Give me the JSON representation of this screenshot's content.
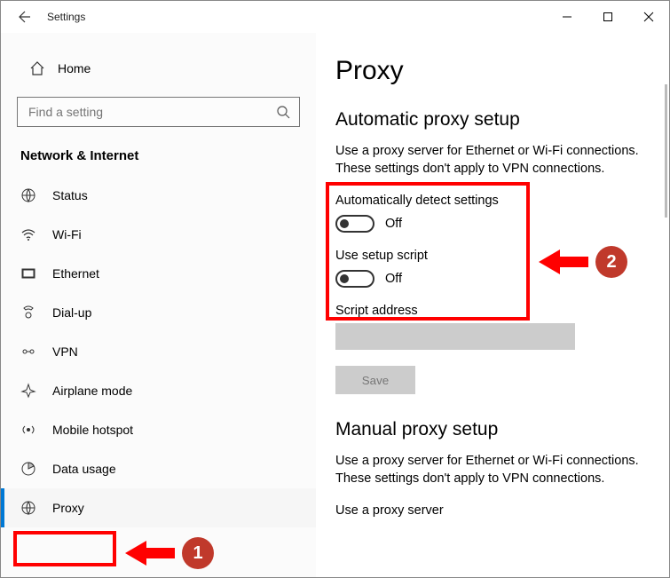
{
  "window": {
    "title": "Settings"
  },
  "sidebar": {
    "home": "Home",
    "search_placeholder": "Find a setting",
    "section": "Network & Internet",
    "items": [
      {
        "label": "Status"
      },
      {
        "label": "Wi-Fi"
      },
      {
        "label": "Ethernet"
      },
      {
        "label": "Dial-up"
      },
      {
        "label": "VPN"
      },
      {
        "label": "Airplane mode"
      },
      {
        "label": "Mobile hotspot"
      },
      {
        "label": "Data usage"
      },
      {
        "label": "Proxy"
      }
    ]
  },
  "main": {
    "heading": "Proxy",
    "auto": {
      "title": "Automatic proxy setup",
      "desc": "Use a proxy server for Ethernet or Wi-Fi connections. These settings don't apply to VPN connections.",
      "detect_label": "Automatically detect settings",
      "detect_state": "Off",
      "script_label": "Use setup script",
      "script_state": "Off",
      "addr_label": "Script address",
      "save": "Save"
    },
    "manual": {
      "title": "Manual proxy setup",
      "desc": "Use a proxy server for Ethernet or Wi-Fi connections. These settings don't apply to VPN connections.",
      "use_label": "Use a proxy server"
    }
  },
  "annotations": {
    "step1": "1",
    "step2": "2"
  }
}
